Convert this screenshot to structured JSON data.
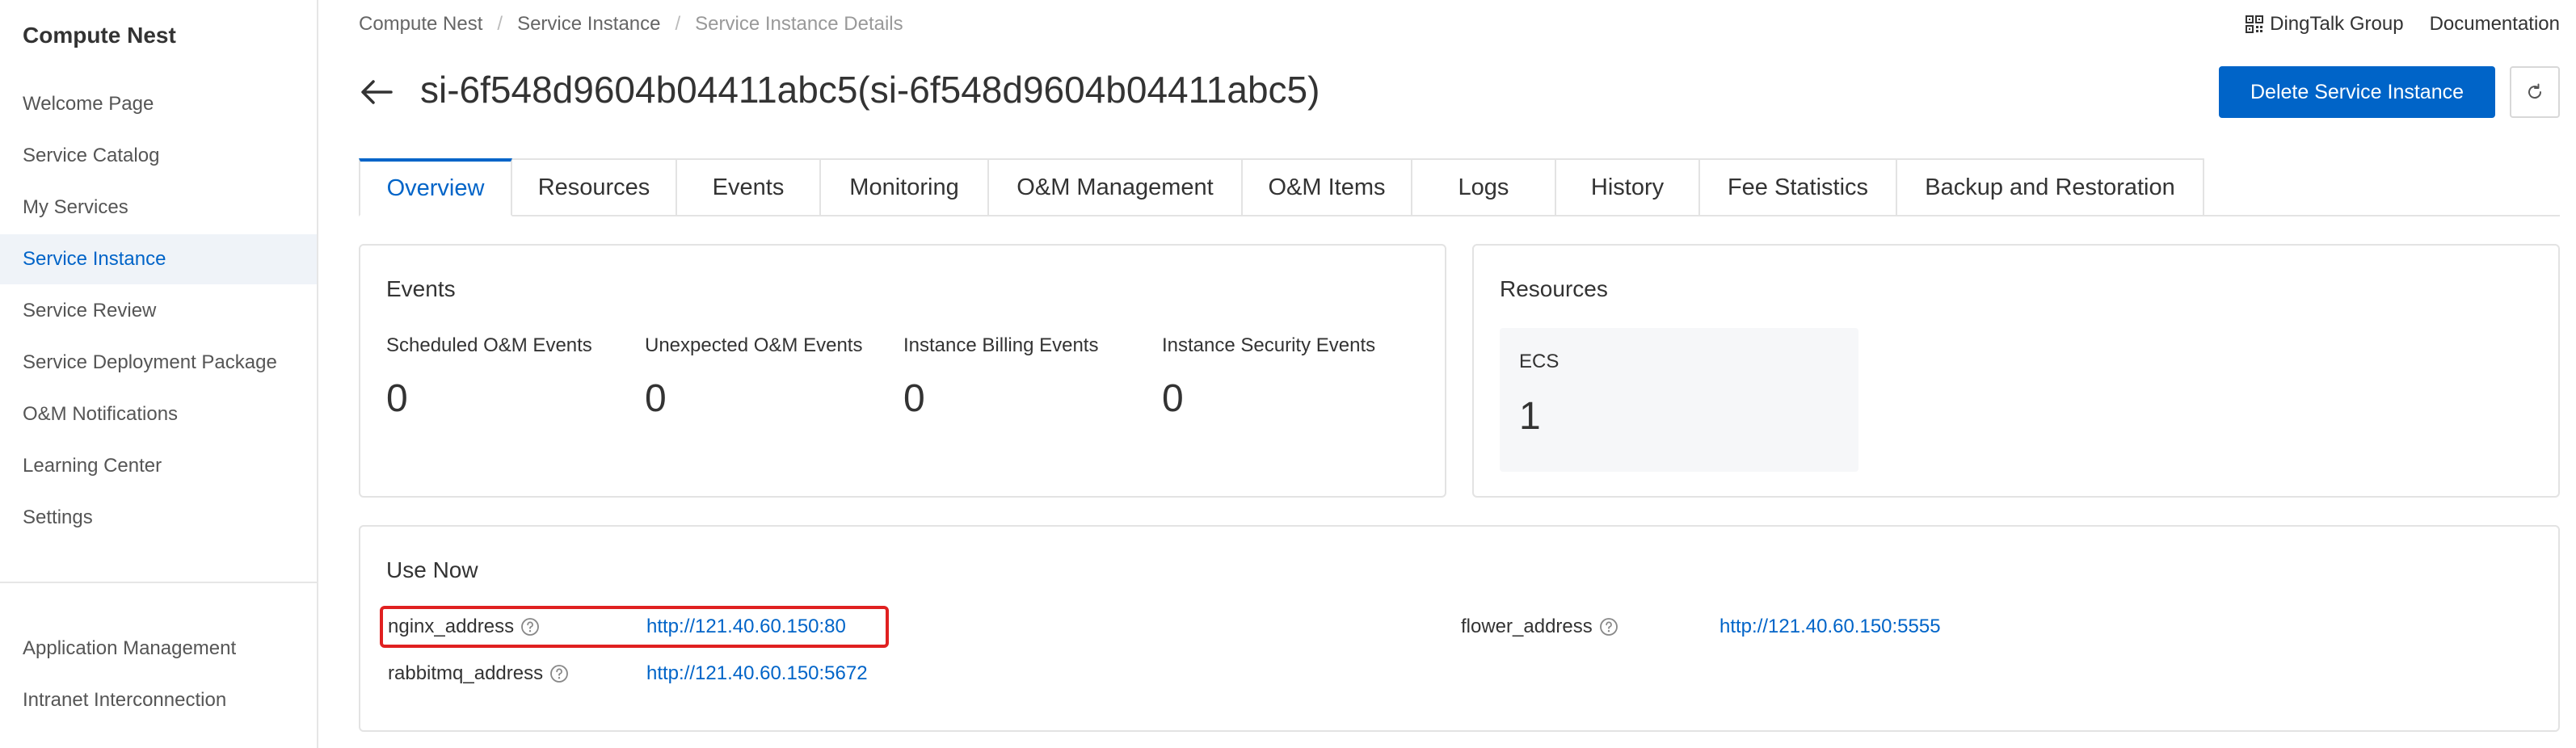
{
  "sidebar": {
    "title": "Compute Nest",
    "items": [
      {
        "label": "Welcome Page"
      },
      {
        "label": "Service Catalog"
      },
      {
        "label": "My Services"
      },
      {
        "label": "Service Instance"
      },
      {
        "label": "Service Review"
      },
      {
        "label": "Service Deployment Package"
      },
      {
        "label": "O&M Notifications"
      },
      {
        "label": "Learning Center"
      },
      {
        "label": "Settings"
      }
    ],
    "bottom_items": [
      {
        "label": "Application Management"
      },
      {
        "label": "Intranet Interconnection"
      }
    ]
  },
  "breadcrumb": {
    "items": [
      "Compute Nest",
      "Service Instance",
      "Service Instance Details"
    ],
    "separator": "/"
  },
  "top_links": {
    "dingtalk": "DingTalk Group",
    "documentation": "Documentation"
  },
  "header": {
    "title": "si-6f548d9604b04411abc5(si-6f548d9604b04411abc5)",
    "delete_button": "Delete Service Instance"
  },
  "tabs": [
    {
      "label": "Overview",
      "active": true
    },
    {
      "label": "Resources"
    },
    {
      "label": "Events"
    },
    {
      "label": "Monitoring"
    },
    {
      "label": "O&M Management"
    },
    {
      "label": "O&M Items"
    },
    {
      "label": "Logs"
    },
    {
      "label": "History"
    },
    {
      "label": "Fee Statistics"
    },
    {
      "label": "Backup and Restoration"
    }
  ],
  "events_card": {
    "title": "Events",
    "stats": [
      {
        "label": "Scheduled O&M Events",
        "value": "0"
      },
      {
        "label": "Unexpected O&M Events",
        "value": "0"
      },
      {
        "label": "Instance Billing Events",
        "value": "0"
      },
      {
        "label": "Instance Security Events",
        "value": "0"
      }
    ]
  },
  "resources_card": {
    "title": "Resources",
    "ecs_label": "ECS",
    "ecs_value": "1"
  },
  "use_now": {
    "title": "Use Now",
    "entries": [
      {
        "label": "nginx_address",
        "value": "http://121.40.60.150:80"
      },
      {
        "label": "rabbitmq_address",
        "value": "http://121.40.60.150:5672"
      },
      {
        "label": "flower_address",
        "value": "http://121.40.60.150:5555"
      }
    ]
  },
  "colors": {
    "accent": "#0064c8",
    "highlight": "#e02020",
    "sidebar_active_bg": "#eff3f8"
  },
  "icons": [
    "back-arrow-icon",
    "refresh-icon",
    "qr-code-icon",
    "help-icon"
  ]
}
